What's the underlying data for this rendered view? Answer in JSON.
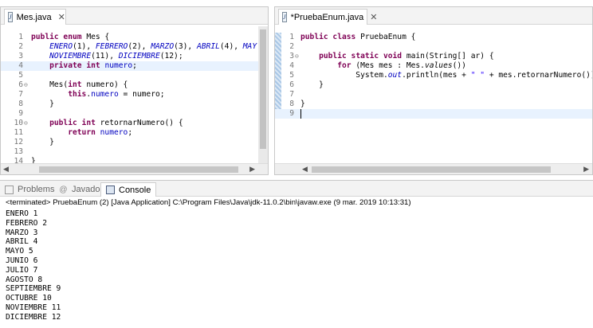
{
  "left_editor": {
    "tab_label": "Mes.java",
    "lines": [
      {
        "n": "1",
        "fold": "",
        "html": "<span class='kw'>public enum</span> Mes {"
      },
      {
        "n": "2",
        "fold": "",
        "html": "    <span class='const'>ENERO</span>(1), <span class='const'>FEBRERO</span>(2), <span class='const'>MARZO</span>(3), <span class='const'>ABRIL</span>(4), <span class='const'>MAY</span>"
      },
      {
        "n": "3",
        "fold": "",
        "html": "    <span class='const'>NOVIEMBRE</span>(11), <span class='const'>DICIEMBRE</span>(12);"
      },
      {
        "n": "4",
        "fold": "",
        "html": "    <span class='kw'>private int</span> <span class='field'>numero</span>;"
      },
      {
        "n": "5",
        "fold": "",
        "html": ""
      },
      {
        "n": "6",
        "fold": "⊖",
        "html": "    Mes(<span class='kw'>int</span> numero) {"
      },
      {
        "n": "7",
        "fold": "",
        "html": "        <span class='kw'>this</span>.<span class='field'>numero</span> = numero;"
      },
      {
        "n": "8",
        "fold": "",
        "html": "    }"
      },
      {
        "n": "9",
        "fold": "",
        "html": ""
      },
      {
        "n": "10",
        "fold": "⊖",
        "html": "    <span class='kw'>public int</span> retornarNumero() {"
      },
      {
        "n": "11",
        "fold": "",
        "html": "        <span class='kw'>return</span> <span class='field'>numero</span>;"
      },
      {
        "n": "12",
        "fold": "",
        "html": "    }"
      },
      {
        "n": "13",
        "fold": "",
        "html": ""
      },
      {
        "n": "14",
        "fold": "",
        "html": "}"
      }
    ]
  },
  "right_editor": {
    "tab_label": "*PruebaEnum.java",
    "lines": [
      {
        "n": "1",
        "fold": "",
        "html": "<span class='kw'>public class</span> PruebaEnum {"
      },
      {
        "n": "2",
        "fold": "",
        "html": ""
      },
      {
        "n": "3",
        "fold": "⊖",
        "html": "    <span class='kw'>public static void</span> main(String[] ar) {"
      },
      {
        "n": "4",
        "fold": "",
        "html": "        <span class='kw'>for</span> (Mes mes : Mes.<span class='static'>values</span>())"
      },
      {
        "n": "5",
        "fold": "",
        "html": "            System.<span class='const'>out</span>.println(mes + <span class='str'>\" \"</span> + mes.retornarNumero());"
      },
      {
        "n": "6",
        "fold": "",
        "html": "    }"
      },
      {
        "n": "7",
        "fold": "",
        "html": ""
      },
      {
        "n": "8",
        "fold": "",
        "html": "}"
      },
      {
        "n": "9",
        "fold": "",
        "html": ""
      }
    ]
  },
  "console": {
    "tabs": {
      "problems": "Problems",
      "javadoc": "Javadoc",
      "console": "Console"
    },
    "status": "<terminated> PruebaEnum (2) [Java Application] C:\\Program Files\\Java\\jdk-11.0.2\\bin\\javaw.exe (9 mar. 2019 10:13:31)",
    "output": [
      "ENERO 1",
      "FEBRERO 2",
      "MARZO 3",
      "ABRIL 4",
      "MAYO 5",
      "JUNIO 6",
      "JULIO 7",
      "AGOSTO 8",
      "SEPTIEMBRE 9",
      "OCTUBRE 10",
      "NOVIEMBRE 11",
      "DICIEMBRE 12"
    ]
  },
  "icons": [
    "java-file-icon",
    "close-icon",
    "problems-icon",
    "javadoc-icon",
    "console-icon",
    "fold-icon"
  ]
}
